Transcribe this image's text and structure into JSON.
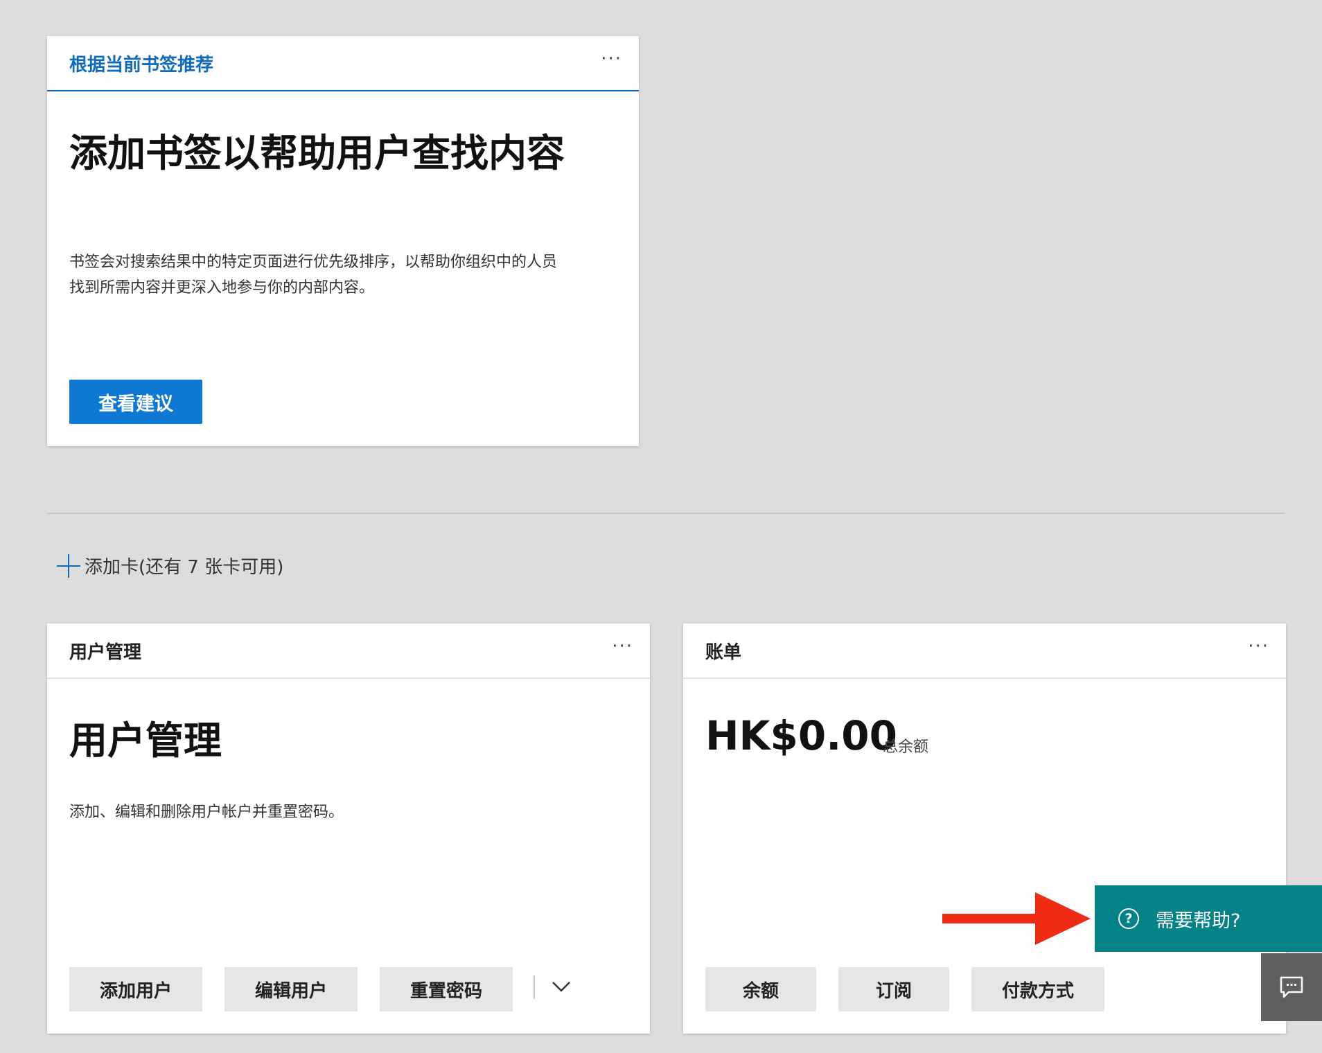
{
  "bookmark_card": {
    "header": "根据当前书签推荐",
    "more": "···",
    "title": "添加书签以帮助用户查找内容",
    "description_line1": "书签会对搜索结果中的特定页面进行优先级排序，以帮助你组织中的人员",
    "description_line2": "找到所需内容并更深入地参与你的内部内容。",
    "button": "查看建议"
  },
  "add_card": {
    "label": "添加卡(还有 7 张卡可用)"
  },
  "user_card": {
    "header": "用户管理",
    "more": "···",
    "title": "用户管理",
    "description": "添加、编辑和删除用户帐户并重置密码。",
    "buttons": [
      "添加用户",
      "编辑用户",
      "重置密码"
    ]
  },
  "billing_card": {
    "header": "账单",
    "more": "···",
    "amount": "HK$0.00",
    "amount_caption": "总余额",
    "buttons": [
      "余额",
      "订阅",
      "付款方式"
    ]
  },
  "help": {
    "label": "需要帮助?",
    "icon": "?"
  },
  "colors": {
    "accent_blue": "#0f6cbd",
    "primary_button": "#0f78d4",
    "help_panel": "#038387",
    "feedback": "#5f5f5f",
    "arrow": "#ee2b13",
    "background": "#dddddd"
  },
  "icons": [
    "plus-icon",
    "more-icon",
    "chevron-down-icon",
    "help-circle-icon",
    "feedback-icon",
    "arrow-right-icon"
  ]
}
